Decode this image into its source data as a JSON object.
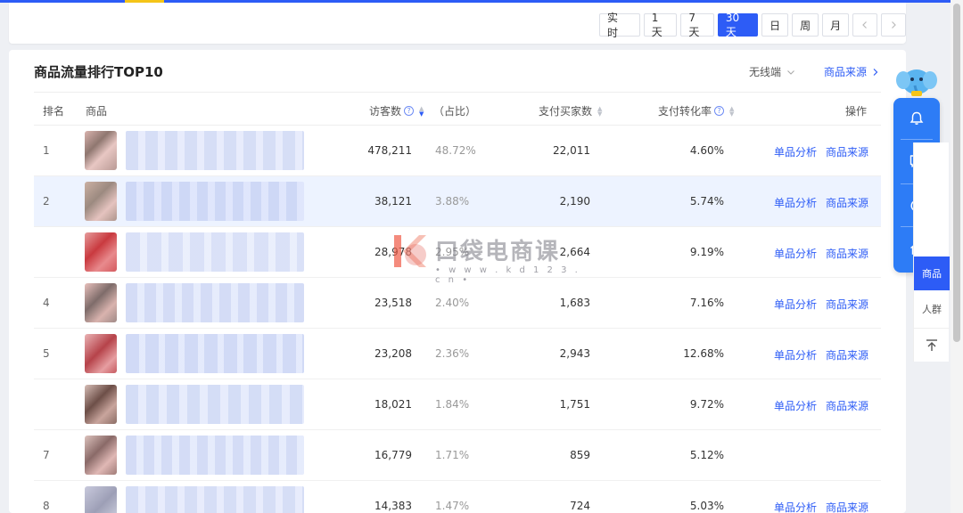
{
  "time_range": {
    "buttons": [
      "实 时",
      "1天",
      "7天",
      "30天",
      "日",
      "周",
      "月"
    ],
    "active": "30天",
    "prev_icon": "chevron-left-icon",
    "next_icon": "chevron-right-icon"
  },
  "card": {
    "title": "商品流量排行TOP10",
    "platform_select": "无线端",
    "source_link": "商品来源"
  },
  "table": {
    "headers": {
      "rank": "排名",
      "product": "商品",
      "visitors": "访客数",
      "share": "（占比）",
      "buyers": "支付买家数",
      "conversion": "支付转化率",
      "action": "操作"
    },
    "rows": [
      {
        "rank": "1",
        "visitors": "478,211",
        "share": "48.72%",
        "buyers": "22,011",
        "conversion": "4.60%",
        "action1": "单品分析",
        "action2": "商品来源"
      },
      {
        "rank": "2",
        "visitors": "38,121",
        "share": "3.88%",
        "buyers": "2,190",
        "conversion": "5.74%",
        "action1": "单品分析",
        "action2": "商品来源"
      },
      {
        "rank": "",
        "visitors": "28,978",
        "share": "2.95%",
        "buyers": "2,664",
        "conversion": "9.19%",
        "action1": "单品分析",
        "action2": "商品来源"
      },
      {
        "rank": "4",
        "visitors": "23,518",
        "share": "2.40%",
        "buyers": "1,683",
        "conversion": "7.16%",
        "action1": "单品分析",
        "action2": "商品来源"
      },
      {
        "rank": "5",
        "visitors": "23,208",
        "share": "2.36%",
        "buyers": "2,943",
        "conversion": "12.68%",
        "action1": "单品分析",
        "action2": "商品来源"
      },
      {
        "rank": "",
        "visitors": "18,021",
        "share": "1.84%",
        "buyers": "1,751",
        "conversion": "9.72%",
        "action1": "单品分析",
        "action2": "商品来源"
      },
      {
        "rank": "7",
        "visitors": "16,779",
        "share": "1.71%",
        "buyers": "859",
        "conversion": "5.12%",
        "action1": "",
        "action2": ""
      },
      {
        "rank": "8",
        "visitors": "14,383",
        "share": "1.47%",
        "buyers": "724",
        "conversion": "5.03%",
        "action1": "单品分析",
        "action2": "商品来源"
      }
    ]
  },
  "watermark": {
    "text": "口袋电商课",
    "url": "• w w w . k d 1 2 3 . c n •"
  },
  "float_panel": {
    "icons": [
      "bell-icon",
      "message-icon",
      "timer-icon",
      "home-icon"
    ]
  },
  "right_tabs": {
    "items": [
      "商品",
      "人群"
    ],
    "back_top_icon": "back-to-top-icon"
  },
  "colors": {
    "accent": "#2d5cf6",
    "float_panel": "#2d7cf6",
    "highlight_row": "#edf3ff"
  }
}
